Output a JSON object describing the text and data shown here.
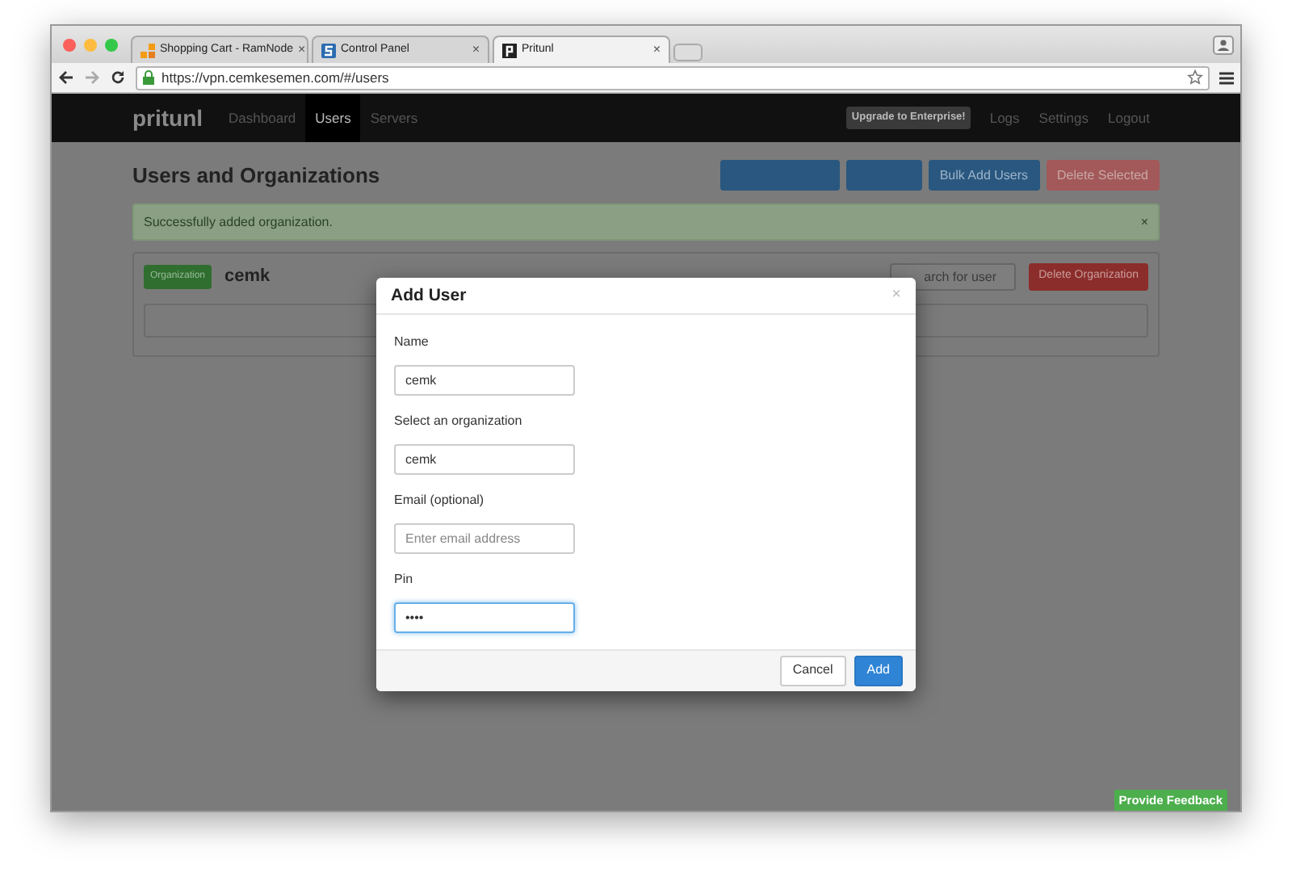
{
  "browser": {
    "tabs": [
      {
        "title": "Shopping Cart - RamNode",
        "close": "×",
        "selected": false
      },
      {
        "title": "Control Panel",
        "close": "×",
        "selected": false
      },
      {
        "title": "Pritunl",
        "close": "×",
        "selected": true
      }
    ],
    "url": "https://vpn.cemkesemen.com/#/users"
  },
  "navbar": {
    "logo": "pritunl",
    "links": [
      {
        "label": "Dashboard",
        "selected": false
      },
      {
        "label": "Users",
        "selected": true
      },
      {
        "label": "Servers",
        "selected": false
      }
    ],
    "upgrade": "Upgrade to Enterprise!",
    "right_links": [
      "Logs",
      "Settings",
      "Logout"
    ]
  },
  "page": {
    "title": "Users and Organizations",
    "buttons": [
      {
        "kind": "hidden"
      },
      {
        "kind": "hidden"
      },
      {
        "label": "Bulk Add Users",
        "kind": "primary"
      },
      {
        "label": "Delete Selected",
        "kind": "danger"
      }
    ],
    "alert": {
      "text": "Successfully added organization.",
      "close": "×"
    },
    "organization": {
      "badge": "Organization",
      "name": "cemk",
      "search_placeholder": "arch for user",
      "delete": "Delete Organization"
    }
  },
  "modal": {
    "title": "Add User",
    "close": "×",
    "fields": [
      {
        "label": "Name",
        "value": "cemk",
        "focused": false
      },
      {
        "label": "Select an organization",
        "value": "cemk",
        "focused": false
      },
      {
        "label": "Email (optional)",
        "placeholder": "Enter email address",
        "focused": false
      },
      {
        "label": "Pin",
        "value": "••••",
        "focused": true
      }
    ],
    "buttons": [
      {
        "label": "Cancel",
        "kind": "default"
      },
      {
        "label": "Add",
        "kind": "primary"
      }
    ]
  },
  "feedback": "Provide Feedback"
}
